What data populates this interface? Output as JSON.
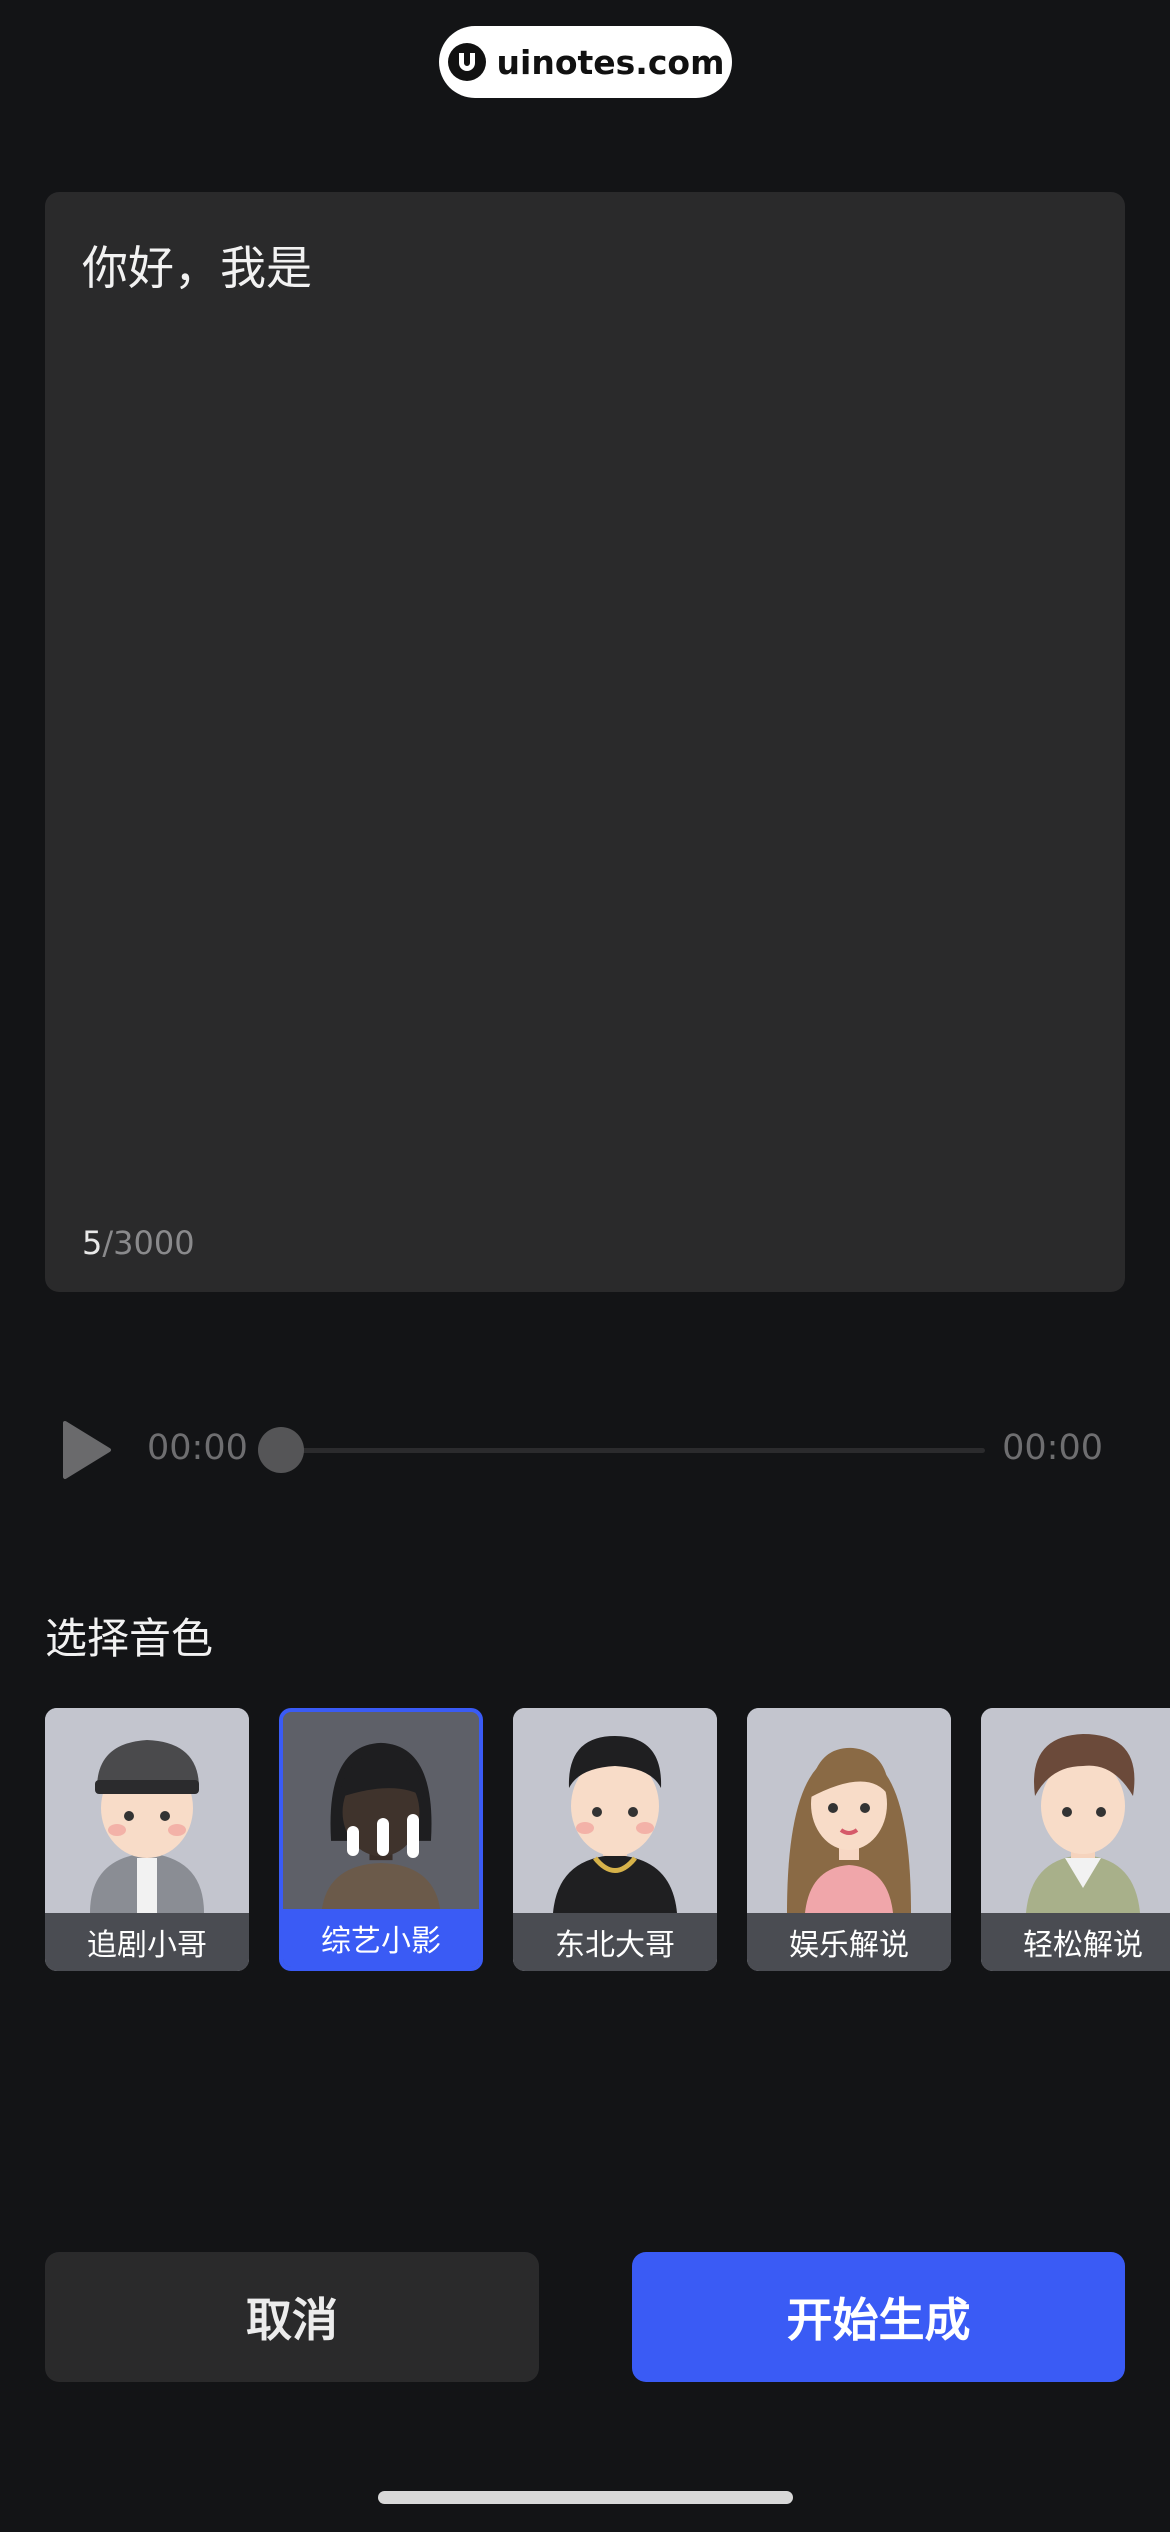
{
  "watermark": {
    "text": "uinotes.com",
    "icon": "uinotes-logo-icon"
  },
  "editor": {
    "text": "你好，我是",
    "count_current": "5",
    "count_max": "/3000"
  },
  "player": {
    "time_start": "00:00",
    "time_end": "00:00",
    "progress": 0,
    "icon": "play-icon"
  },
  "voice_section": {
    "title": "选择音色"
  },
  "voices": [
    {
      "label": "追剧小哥",
      "selected": false
    },
    {
      "label": "综艺小影",
      "selected": true
    },
    {
      "label": "东北大哥",
      "selected": false
    },
    {
      "label": "娱乐解说",
      "selected": false
    },
    {
      "label": "轻松解说",
      "selected": false
    }
  ],
  "actions": {
    "cancel": "取消",
    "start": "开始生成"
  },
  "colors": {
    "accent": "#3a5bf5",
    "background": "#131416",
    "panel": "#2a2a2b"
  }
}
